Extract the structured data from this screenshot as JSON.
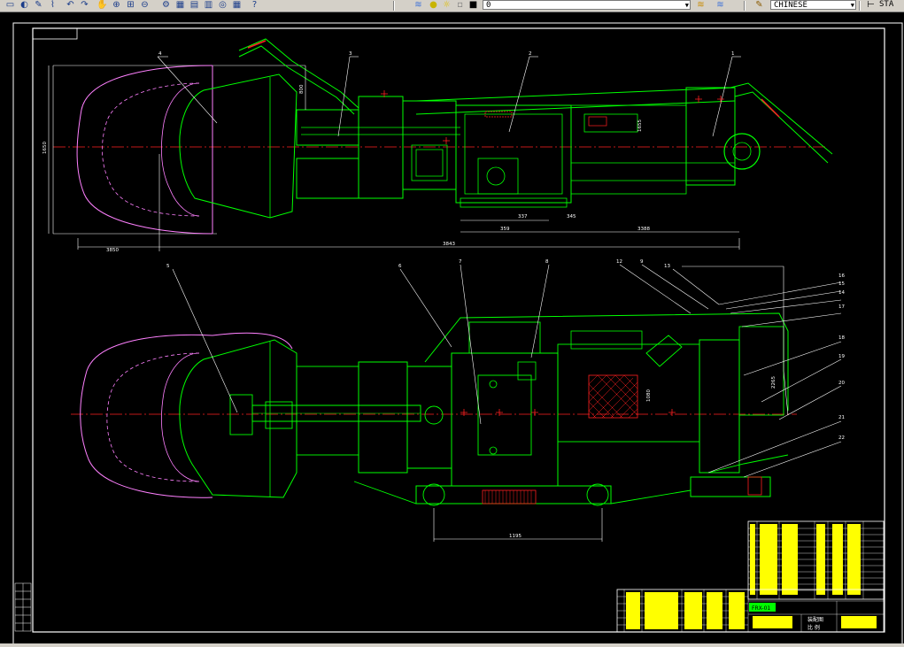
{
  "toolbar": {
    "items": [
      {
        "name": "new-icon",
        "glyph": "▭"
      },
      {
        "name": "open-icon",
        "glyph": "◐"
      },
      {
        "name": "pencil-icon",
        "glyph": "✎"
      },
      {
        "name": "brush-icon",
        "glyph": "⌇"
      },
      {
        "name": "undo-icon",
        "glyph": "↶"
      },
      {
        "name": "redo-icon",
        "glyph": "↷"
      },
      {
        "name": "pan-icon",
        "glyph": "✋"
      },
      {
        "name": "zoom-realtime-icon",
        "glyph": "⊕"
      },
      {
        "name": "zoom-window-icon",
        "glyph": "⊞"
      },
      {
        "name": "zoom-previous-icon",
        "glyph": "⊖"
      },
      {
        "name": "properties-icon",
        "glyph": "⚙"
      },
      {
        "name": "design-center-icon",
        "glyph": "▦"
      },
      {
        "name": "tool-palette-icon",
        "glyph": "▤"
      },
      {
        "name": "sheet-set-icon",
        "glyph": "▥"
      },
      {
        "name": "markup-icon",
        "glyph": "◎"
      },
      {
        "name": "calculator-icon",
        "glyph": "▦"
      },
      {
        "name": "help-icon",
        "glyph": "?"
      }
    ],
    "layer_value": "0",
    "layer_icons": [
      "layers-icon",
      "bulb-icon",
      "sun-icon",
      "lock-icon",
      "color-icon"
    ],
    "style_value": "CHINESE",
    "dim_style_value": "STA",
    "colors": {
      "face": "#d4d0c8",
      "accent": "#1a3c8a"
    }
  },
  "drawing": {
    "background": "#000000",
    "colors": {
      "outline": "#00ff00",
      "red": "#ff2020",
      "white": "#ffffff",
      "magenta": "#ff80ff",
      "yellow": "#ffff00",
      "cyan": "#00ffff"
    },
    "top_view": {
      "part_numbers": [
        "4",
        "3",
        "2",
        "1"
      ],
      "dimensions": [
        "3850",
        "1650",
        "337",
        "345",
        "359",
        "3388",
        "3843",
        "800",
        "1655"
      ]
    },
    "bottom_view": {
      "part_numbers": [
        "5",
        "6",
        "7",
        "8",
        "12",
        "9",
        "13",
        "16",
        "15",
        "14",
        "17",
        "18",
        "19",
        "20",
        "21",
        "22"
      ],
      "dimensions": [
        "1195",
        "1080",
        "2265"
      ]
    },
    "title_block": {
      "drawing_code": "FRX-01",
      "label_assembly": "装配图",
      "label_ratio": "比 例"
    }
  }
}
